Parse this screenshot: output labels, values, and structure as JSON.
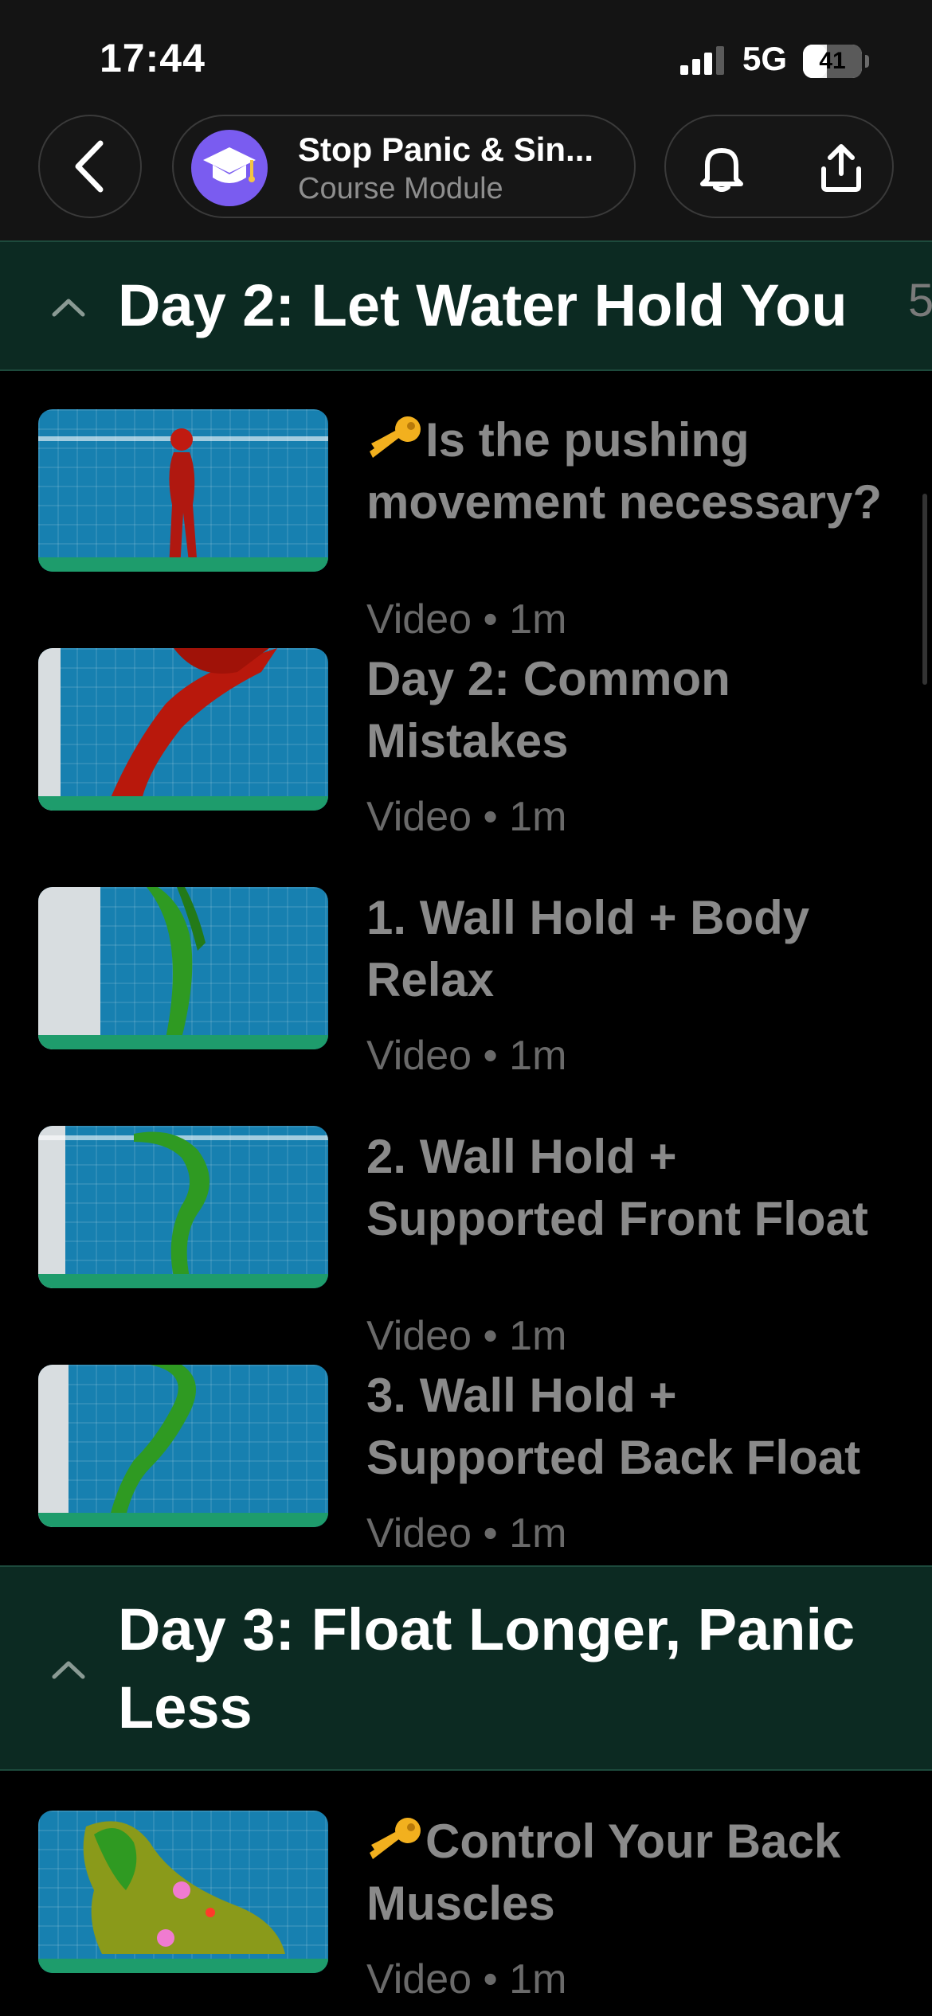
{
  "status_bar": {
    "time": "17:44",
    "network": "5G",
    "battery": 41
  },
  "nav": {
    "course_title": "Stop Panic & Sin...",
    "course_subtitle": "Course Module"
  },
  "sections": [
    {
      "title": "Day 2: Let Water Hold You",
      "count": "5",
      "lessons": [
        {
          "title": "Is the pushing movement necessary?",
          "key": true,
          "meta": "Video • 1m"
        },
        {
          "title": "Day 2: Common Mistakes",
          "key": false,
          "meta": "Video • 1m"
        },
        {
          "title": "1. Wall Hold + Body Relax",
          "key": false,
          "meta": "Video • 1m"
        },
        {
          "title": "2. Wall Hold + Supported Front Float",
          "key": false,
          "meta": "Video • 1m"
        },
        {
          "title": "3. Wall Hold + Supported Back Float",
          "key": false,
          "meta": "Video • 1m"
        }
      ]
    },
    {
      "title": "Day 3: Float Longer, Panic Less",
      "lessons": [
        {
          "title": "Control Your Back Muscles",
          "key": true,
          "meta": "Video • 1m"
        }
      ]
    }
  ],
  "colors": {
    "section_bg": "#0c2a22",
    "progress": "#1e9c6c",
    "water": "#1780b0"
  }
}
